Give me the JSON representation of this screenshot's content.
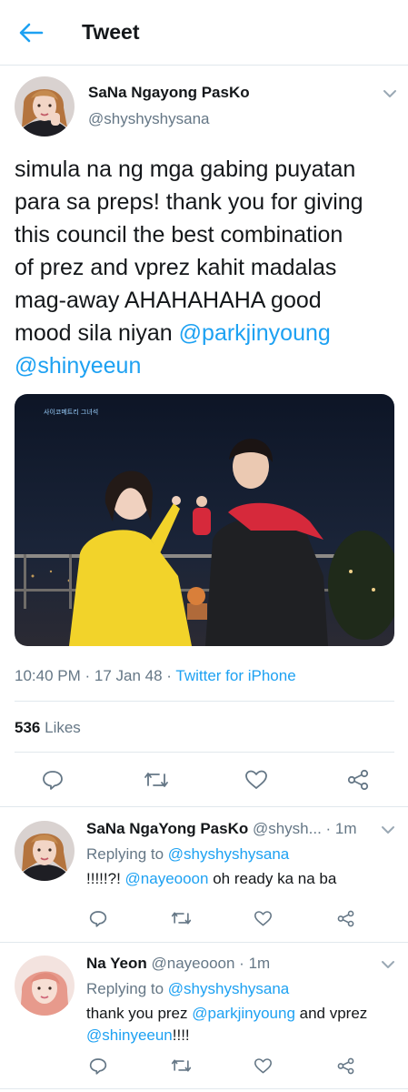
{
  "header": {
    "title": "Tweet"
  },
  "main_tweet": {
    "display_name": "SaNa Ngayong PasKo",
    "handle": "@shyshyshysana",
    "text_line1": "simula na ng mga gabing puyatan",
    "text_line2": "para sa preps! thank you for giving",
    "text_line3": "this council the best combination",
    "text_line4": "of prez and vprez kahit madalas",
    "text_line5": "mag-away AHAHAHAHA good",
    "text_line6_prefix": "mood sila niyan ",
    "mention1": "@parkjinyoung",
    "mention2": "@shinyeeun",
    "media_logo_text": "사이코메트리 그녀석",
    "time": "10:40 PM",
    "date": "17 Jan 48",
    "separator": " · ",
    "source": "Twitter for iPhone",
    "likes_count": "536",
    "likes_label": "Likes"
  },
  "replies": [
    {
      "display_name": "SaNa NgaYong PasKo",
      "handle_time": "@shysh... · 1m",
      "replying_label": "Replying to ",
      "replying_to": "@shyshyshysana",
      "text_prefix": "!!!!!?! ",
      "mention": "@nayeooon",
      "text_suffix": " oh ready ka na ba"
    },
    {
      "display_name": "Na Yeon",
      "handle_time": "@nayeooon · 1m",
      "replying_label": "Replying to ",
      "replying_to": "@shyshyshysana",
      "text_prefix": "thank you prez ",
      "mention": "@parkjinyoung",
      "text_middle": " and vprez",
      "mention2": "@shinyeeun",
      "text_suffix": "!!!!"
    }
  ],
  "icons": {
    "back": "arrow-left-icon",
    "reply": "comment-icon",
    "retweet": "retweet-icon",
    "like": "heart-icon",
    "share": "share-icon",
    "more": "chevron-down-icon"
  },
  "colors": {
    "accent": "#1da1f2",
    "text": "#14171a",
    "muted": "#657786",
    "border": "#e1e8ed"
  }
}
